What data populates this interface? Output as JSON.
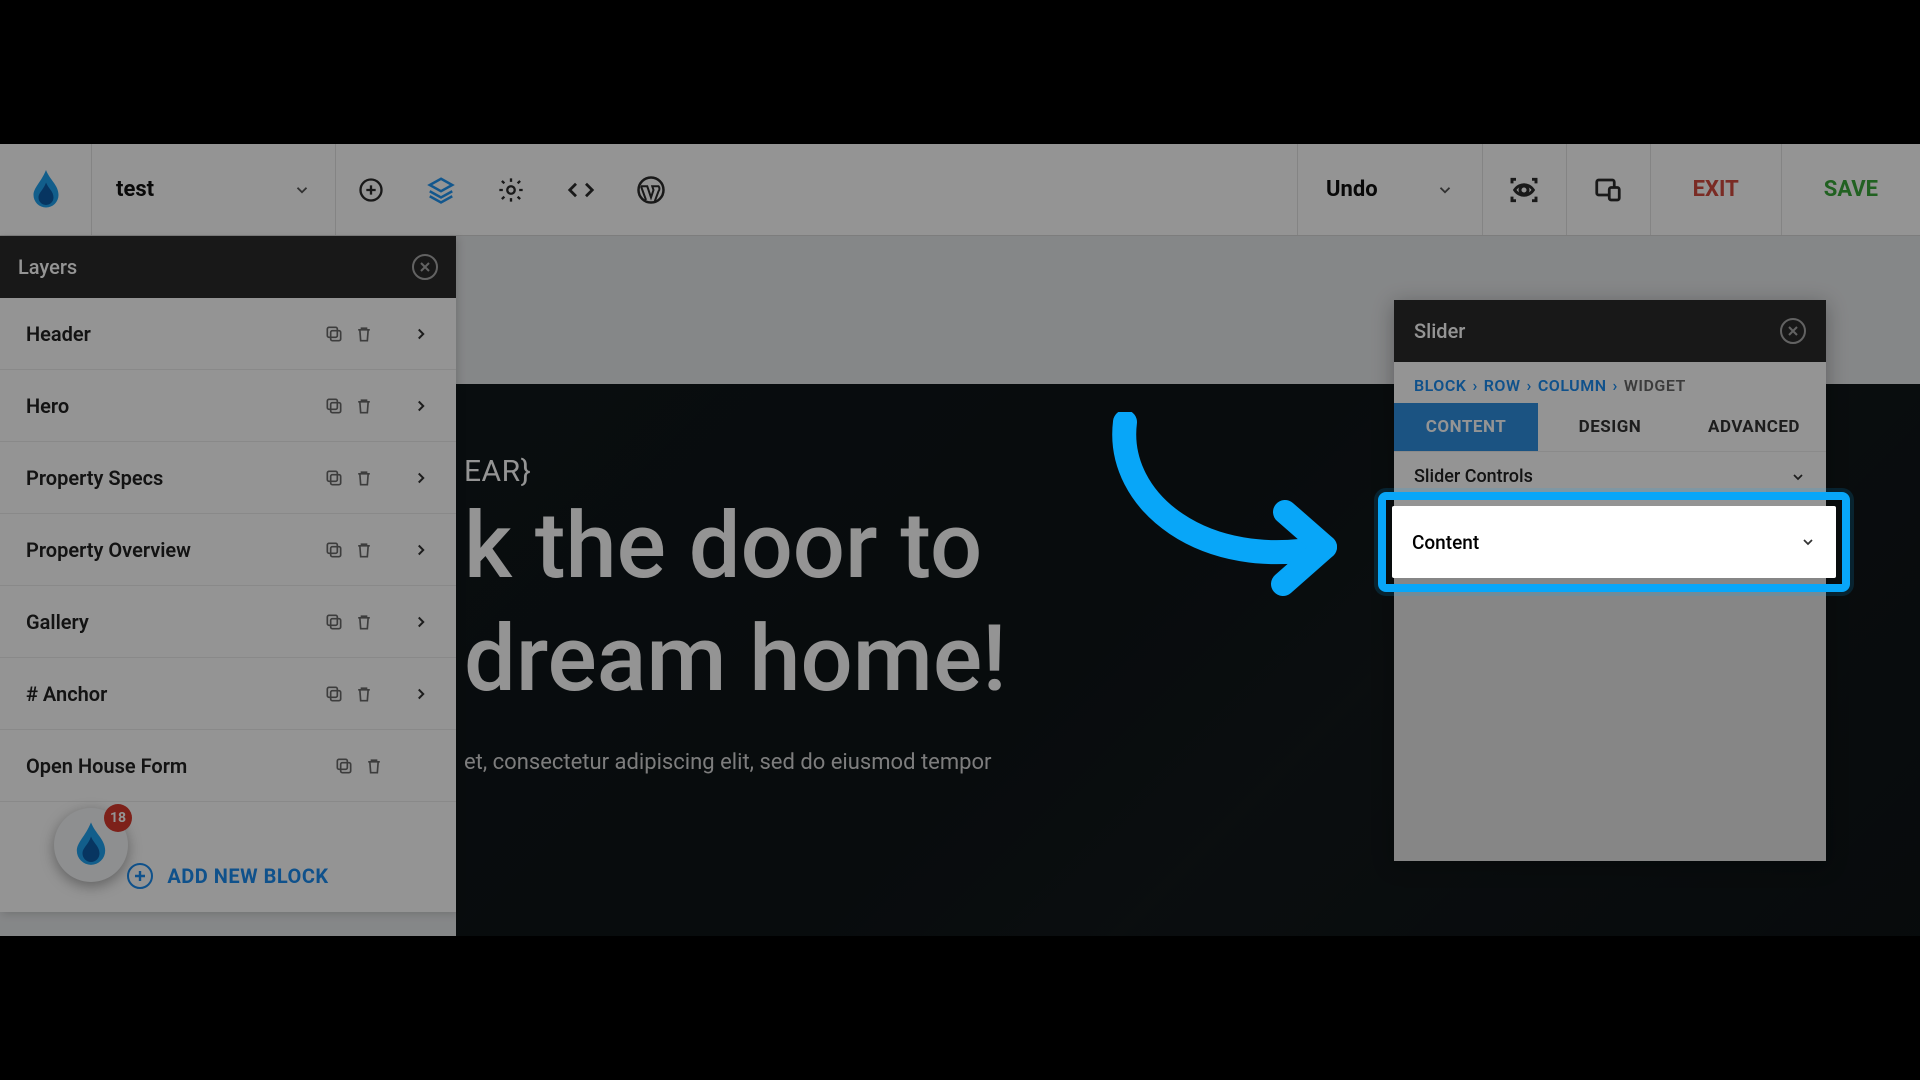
{
  "topbar": {
    "title": "test",
    "undo_label": "Undo",
    "exit_label": "EXIT",
    "save_label": "SAVE"
  },
  "layers": {
    "panel_title": "Layers",
    "items": [
      {
        "label": "Header",
        "expandable": true
      },
      {
        "label": "Hero",
        "expandable": true
      },
      {
        "label": "Property Specs",
        "expandable": true
      },
      {
        "label": "Property Overview",
        "expandable": true
      },
      {
        "label": "Gallery",
        "expandable": true
      },
      {
        "label": "# Anchor",
        "expandable": true
      },
      {
        "label": "Open House Form",
        "expandable": false
      }
    ],
    "add_label": "ADD NEW BLOCK"
  },
  "avatar": {
    "badge": "18"
  },
  "canvas": {
    "eyebrow": "EAR}",
    "headline_1": "k the door to",
    "headline_2": "dream home!",
    "sub": "et, consectetur adipiscing elit, sed do eiusmod tempor"
  },
  "inspector": {
    "title": "Slider",
    "breadcrumbs": [
      {
        "label": "BLOCK",
        "link": true
      },
      {
        "label": "ROW",
        "link": true
      },
      {
        "label": "COLUMN",
        "link": true
      },
      {
        "label": "WIDGET",
        "link": false
      }
    ],
    "tabs": [
      {
        "label": "CONTENT",
        "active": true
      },
      {
        "label": "DESIGN",
        "active": false
      },
      {
        "label": "ADVANCED",
        "active": false
      }
    ],
    "sections": {
      "slider_controls": "Slider Controls",
      "content": "Content"
    }
  }
}
